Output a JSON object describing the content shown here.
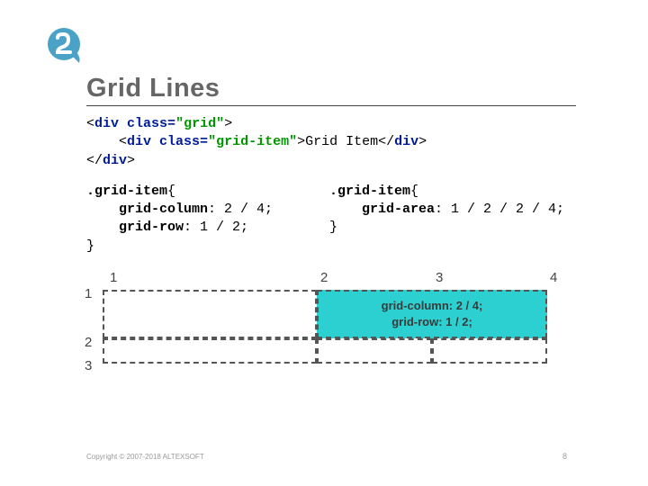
{
  "title": "Grid Lines",
  "html_lines": [
    [
      {
        "cls": "txt",
        "t": "<"
      },
      {
        "cls": "tag",
        "t": "div"
      },
      {
        "cls": "txt",
        "t": " "
      },
      {
        "cls": "attr",
        "t": "class="
      },
      {
        "cls": "str",
        "t": "\"grid\""
      },
      {
        "cls": "txt",
        "t": ">"
      }
    ],
    [
      {
        "cls": "txt",
        "t": "    <"
      },
      {
        "cls": "tag",
        "t": "div"
      },
      {
        "cls": "txt",
        "t": " "
      },
      {
        "cls": "attr",
        "t": "class="
      },
      {
        "cls": "str",
        "t": "\"grid-item\""
      },
      {
        "cls": "txt",
        "t": ">"
      },
      {
        "cls": "txt",
        "t": "Grid Item"
      },
      {
        "cls": "txt",
        "t": "</"
      },
      {
        "cls": "tag",
        "t": "div"
      },
      {
        "cls": "txt",
        "t": ">"
      }
    ],
    [
      {
        "cls": "txt",
        "t": "</"
      },
      {
        "cls": "tag",
        "t": "div"
      },
      {
        "cls": "txt",
        "t": ">"
      }
    ]
  ],
  "css_left": [
    [
      {
        "cls": "sel",
        "t": ".grid-item"
      },
      {
        "cls": "brace",
        "t": "{"
      }
    ],
    [
      {
        "cls": "txt",
        "t": "    "
      },
      {
        "cls": "prop",
        "t": "grid-column"
      },
      {
        "cls": "txt",
        "t": ": 2 / 4;"
      }
    ],
    [
      {
        "cls": "txt",
        "t": "    "
      },
      {
        "cls": "prop",
        "t": "grid-row"
      },
      {
        "cls": "txt",
        "t": ": 1 / 2;"
      }
    ],
    [
      {
        "cls": "brace",
        "t": "}"
      }
    ]
  ],
  "css_right": [
    [
      {
        "cls": "sel",
        "t": ".grid-item"
      },
      {
        "cls": "brace",
        "t": "{"
      }
    ],
    [
      {
        "cls": "txt",
        "t": "    "
      },
      {
        "cls": "prop",
        "t": "grid-area"
      },
      {
        "cls": "txt",
        "t": ": 1 / 2 / 2 / 4;"
      }
    ],
    [
      {
        "cls": "brace",
        "t": "}"
      }
    ]
  ],
  "diagram": {
    "col_labels": [
      "1",
      "2",
      "3",
      "4"
    ],
    "row_labels": [
      "1",
      "2",
      "3"
    ],
    "highlight_lines": [
      "grid-column: 2 / 4;",
      "grid-row: 1 / 2;"
    ]
  },
  "footer": "Copyright © 2007-2018 ALTEXSOFT",
  "page": "8"
}
